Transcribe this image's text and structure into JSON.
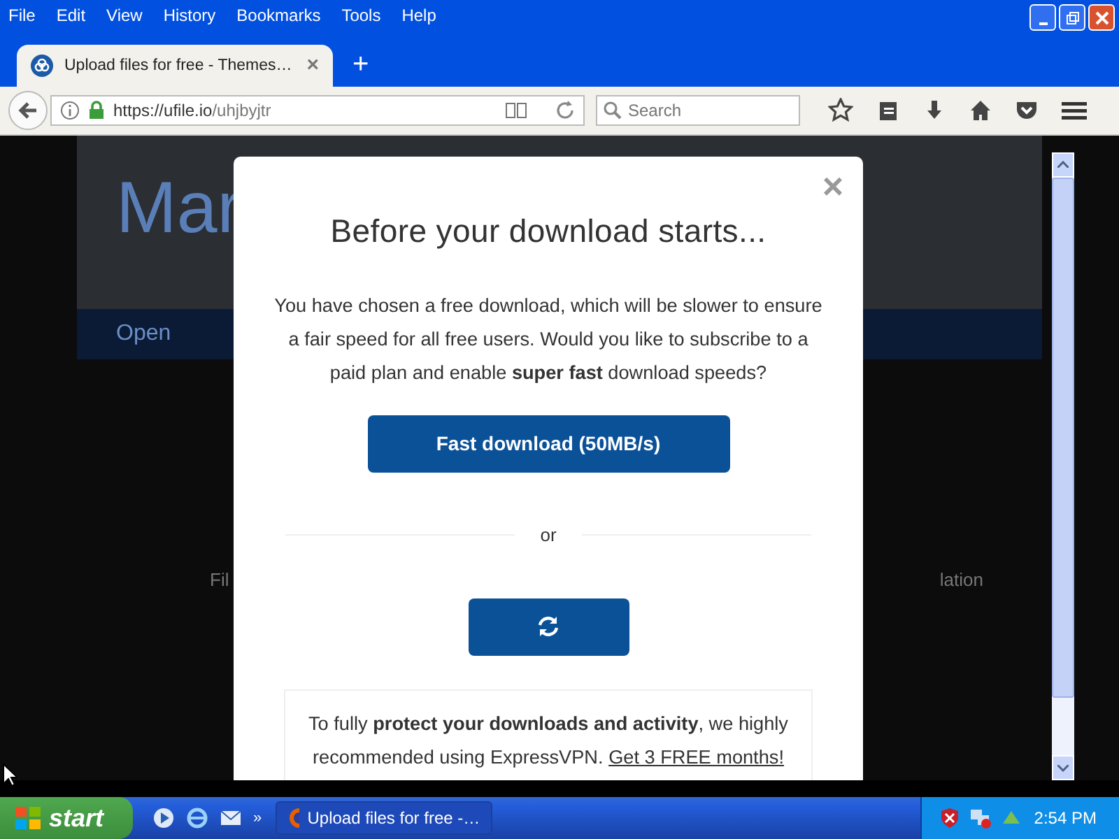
{
  "menu_bar": [
    "File",
    "Edit",
    "View",
    "History",
    "Bookmarks",
    "Tools",
    "Help"
  ],
  "tabs": [
    {
      "title": "Upload files for free - Themes…",
      "close": "×",
      "selected": true
    }
  ],
  "new_tab": "+",
  "address_bar": {
    "url_host": "https://ufile.io",
    "url_path": "/uhjbyjtr"
  },
  "search": {
    "placeholder": "Search"
  },
  "background_page": {
    "heading": "Mar",
    "open_label": "Open",
    "left_text": "Fil",
    "right_text": "lation"
  },
  "modal": {
    "close": "×",
    "title": "Before your download starts...",
    "message": "You have chosen a free download, which will be slower to ensure a fair speed for all free users. Would you like to subscribe to a paid plan and enable **super fast** download speeds?",
    "fast_button": "Fast download (50MB/s)",
    "separator": "or",
    "vpn_text": "To fully **protect your downloads and activity**, we highly recommended using ExpressVPN.",
    "vpn_link": "Get 3 FREE months!"
  },
  "taskbar": {
    "start": "start",
    "more": "»",
    "tasks": [
      {
        "title": "Upload files for free -…",
        "selected": true
      }
    ],
    "clock": "2:54 PM"
  }
}
